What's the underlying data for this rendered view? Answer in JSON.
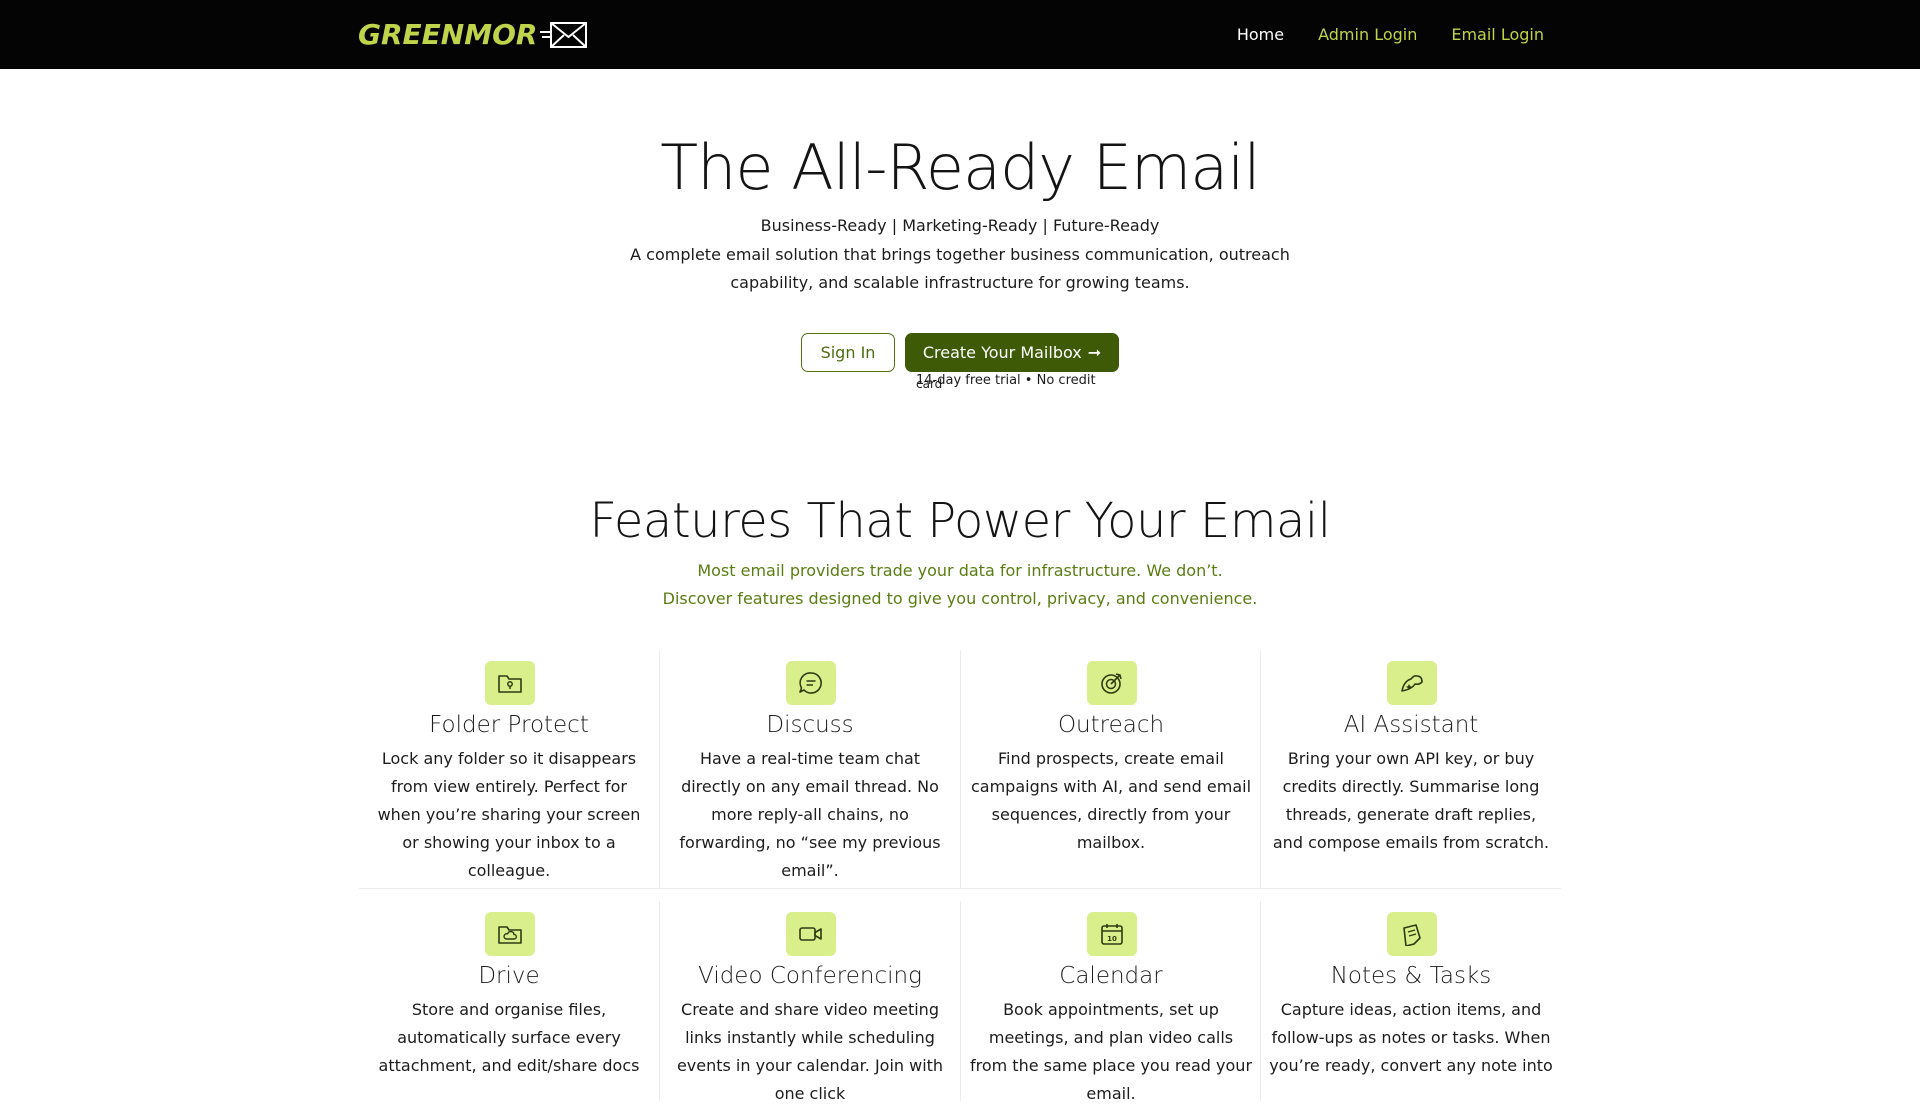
{
  "header": {
    "logo_text": "GREENMOR",
    "nav": {
      "home": "Home",
      "admin_login": "Admin Login",
      "email_login": "Email Login"
    }
  },
  "hero": {
    "title": "The All-Ready Email",
    "tagline": "Business-Ready | Marketing-Ready | Future-Ready",
    "description": "A complete email solution that brings together business communication, outreach capability, and scalable infrastructure for growing teams.",
    "sign_in_label": "Sign In",
    "create_label": "Create Your Mailbox",
    "create_arrow": "➞",
    "trial_note_1": "14-day free trial • No credit",
    "trial_note_2": "card"
  },
  "features": {
    "title": "Features That Power Your Email",
    "subtitle_1": "Most email providers trade your data for infrastructure. We don’t.",
    "subtitle_2": "Discover features designed to give you control, privacy, and convenience.",
    "items": [
      {
        "icon": "folder-lock-icon",
        "title": "Folder Protect",
        "description": "Lock any folder so it disappears from view entirely. Perfect for when you’re sharing your screen or showing your inbox to a colleague."
      },
      {
        "icon": "chat-bubble-icon",
        "title": "Discuss",
        "description": "Have a real-time team chat directly on any email thread. No more reply-all chains, no forwarding, no “see my previous email”."
      },
      {
        "icon": "target-icon",
        "title": "Outreach",
        "description": "Find prospects, create email campaigns with AI, and send email sequences, directly from your mailbox."
      },
      {
        "icon": "ai-sparkle-icon",
        "title": "AI Assistant",
        "description": "Bring your own API key, or buy credits directly. Summarise long threads, generate draft replies, and compose emails from scratch."
      },
      {
        "icon": "folder-cloud-icon",
        "title": "Drive",
        "description": "Store and organise files, automatically surface every attachment, and edit/share docs"
      },
      {
        "icon": "video-camera-icon",
        "title": "Video Conferencing",
        "description": "Create and share video meeting links instantly while scheduling events in your calendar. Join with one click"
      },
      {
        "icon": "calendar-icon",
        "title": "Calendar",
        "description": "Book appointments, set up meetings, and plan video calls from the same place you read your email."
      },
      {
        "icon": "note-icon",
        "title": "Notes & Tasks",
        "description": "Capture ideas, action items, and follow-ups as notes or tasks. When you’re ready, convert any note into"
      }
    ]
  },
  "colors": {
    "navbar_bg": "#040404",
    "brand_lime": "#bfd44a",
    "accent_green": "#3e5a07",
    "subtitle_green": "#5a7d12",
    "icon_bg": "#d9ef8b"
  }
}
